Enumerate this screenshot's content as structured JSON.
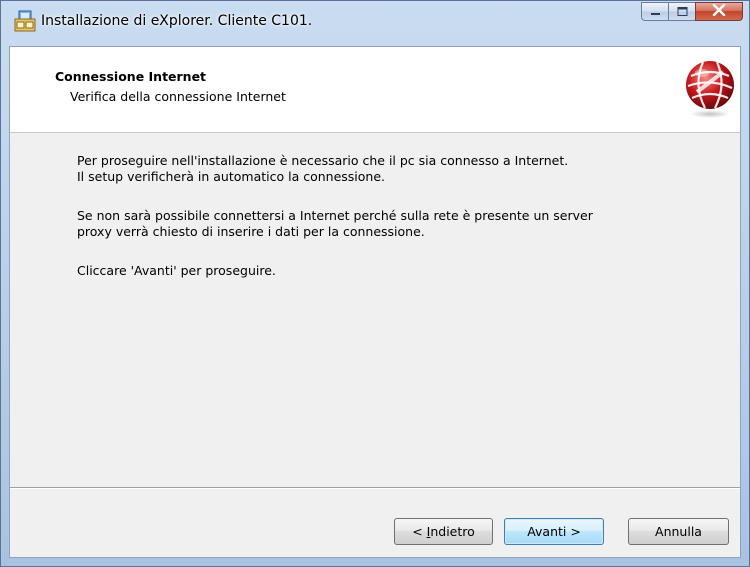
{
  "window": {
    "title": "Installazione di eXplorer. Cliente C101.",
    "icon": "installer-icon",
    "caption_buttons": [
      "minimize-icon",
      "maximize-icon",
      "close-icon"
    ]
  },
  "header": {
    "title": "Connessione Internet",
    "subtitle": "Verifica della connessione Internet",
    "logo": "globe-logo"
  },
  "body": {
    "paragraph1_line1": "Per proseguire nell'installazione è necessario che il pc sia connesso a Internet.",
    "paragraph1_line2": "Il setup verificherà in automatico la connessione.",
    "paragraph2_line1": "Se non sarà possibile connettersi a Internet perché sulla rete è presente un server",
    "paragraph2_line2": "proxy verrà chiesto di inserire i dati per la connessione.",
    "paragraph3": "Cliccare 'Avanti' per proseguire."
  },
  "buttons": {
    "back_prefix": "< ",
    "back_accel": "I",
    "back_rest": "ndietro",
    "next": "Avanti >",
    "cancel": "Annulla"
  },
  "colors": {
    "logo_red": "#c4161c",
    "window_frame": "#b7cde8",
    "default_button": "#3c7fb1"
  }
}
